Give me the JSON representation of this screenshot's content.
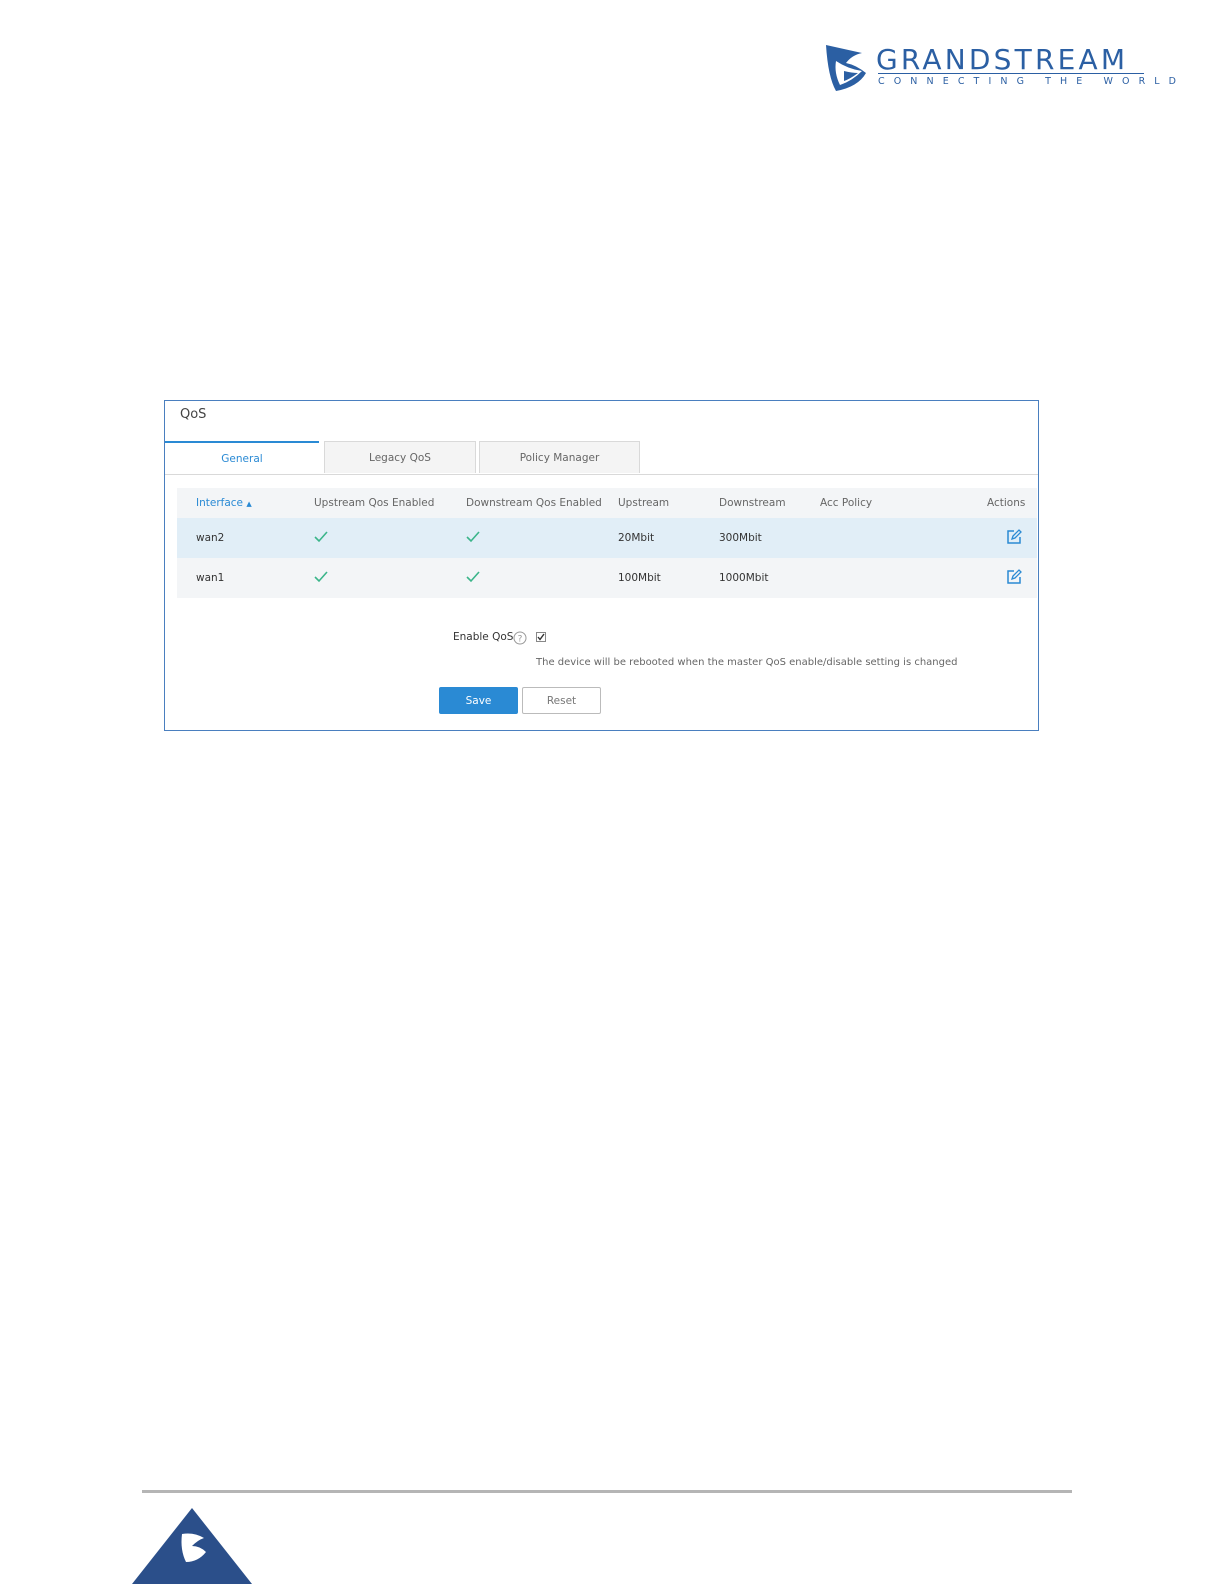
{
  "brand": {
    "name": "GRANDSTREAM",
    "tagline": "CONNECTING THE WORLD",
    "color": "#2b5fa3"
  },
  "panel": {
    "title": "QoS",
    "tabs": [
      {
        "label": "General",
        "active": true
      },
      {
        "label": "Legacy QoS",
        "active": false
      },
      {
        "label": "Policy Manager",
        "active": false
      }
    ],
    "table": {
      "headers": [
        "Interface",
        "Upstream Qos Enabled",
        "Downstream Qos Enabled",
        "Upstream",
        "Downstream",
        "Acc Policy",
        "Actions"
      ],
      "sort_indicator": "▲",
      "rows": [
        {
          "interface": "wan2",
          "upstream_qos": true,
          "downstream_qos": true,
          "upstream": "20Mbit",
          "downstream": "300Mbit",
          "acc_policy": ""
        },
        {
          "interface": "wan1",
          "upstream_qos": true,
          "downstream_qos": true,
          "upstream": "100Mbit",
          "downstream": "1000Mbit",
          "acc_policy": ""
        }
      ]
    },
    "enable_qos": {
      "label": "Enable QoS",
      "checked": true,
      "note": "The device will be rebooted when the master QoS enable/disable setting is changed"
    },
    "buttons": {
      "save": "Save",
      "reset": "Reset"
    }
  },
  "icons": {
    "check": "check-icon",
    "edit": "edit-icon",
    "help": "help-icon"
  },
  "colors": {
    "accent": "#2a8ad4",
    "check": "#3bb58a",
    "row_highlight": "#e1eef7"
  }
}
